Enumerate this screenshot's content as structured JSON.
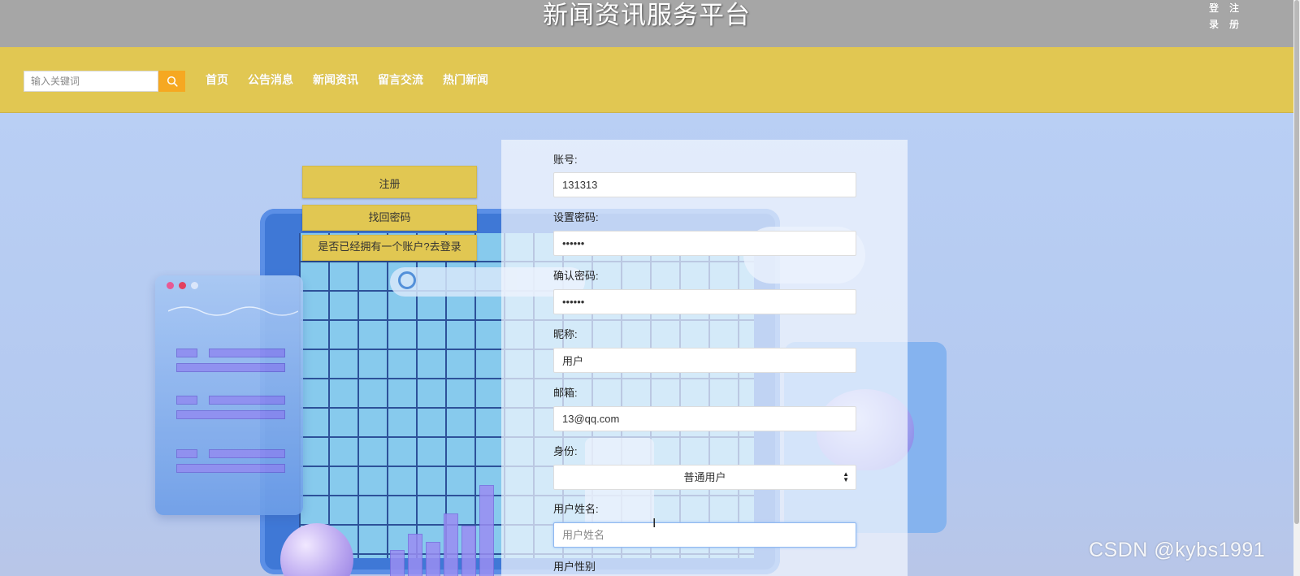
{
  "header": {
    "site_title": "新闻资讯服务平台",
    "login_link": "登录",
    "register_link": "注册"
  },
  "nav": {
    "search_placeholder": "输入关键词",
    "items": [
      "首页",
      "公告消息",
      "新闻资讯",
      "留言交流",
      "热门新闻"
    ]
  },
  "side_buttons": {
    "register": "注册",
    "forgot_password": "找回密码",
    "go_login": "是否已经拥有一个账户?去登录"
  },
  "form": {
    "account_label": "账号:",
    "account_value": "131313",
    "password_label": "设置密码:",
    "password_value": "••••••",
    "confirm_label": "确认密码:",
    "confirm_value": "••••••",
    "nickname_label": "昵称:",
    "nickname_value": "用户",
    "email_label": "邮箱:",
    "email_value": "13@qq.com",
    "identity_label": "身份:",
    "identity_selected": "普通用户",
    "realname_label": "用户姓名:",
    "realname_placeholder": "用户姓名",
    "gender_label": "用户性别"
  },
  "watermark": "CSDN @kybs1991",
  "colors": {
    "header_bg": "#a6a6a6",
    "nav_bg": "#e1c752",
    "search_button": "#f6a821",
    "page_bg": "#b7cdf2"
  },
  "icons": {
    "search": "search-icon",
    "select_arrows": "sort-arrows-icon",
    "cursor": "text-cursor-icon"
  }
}
